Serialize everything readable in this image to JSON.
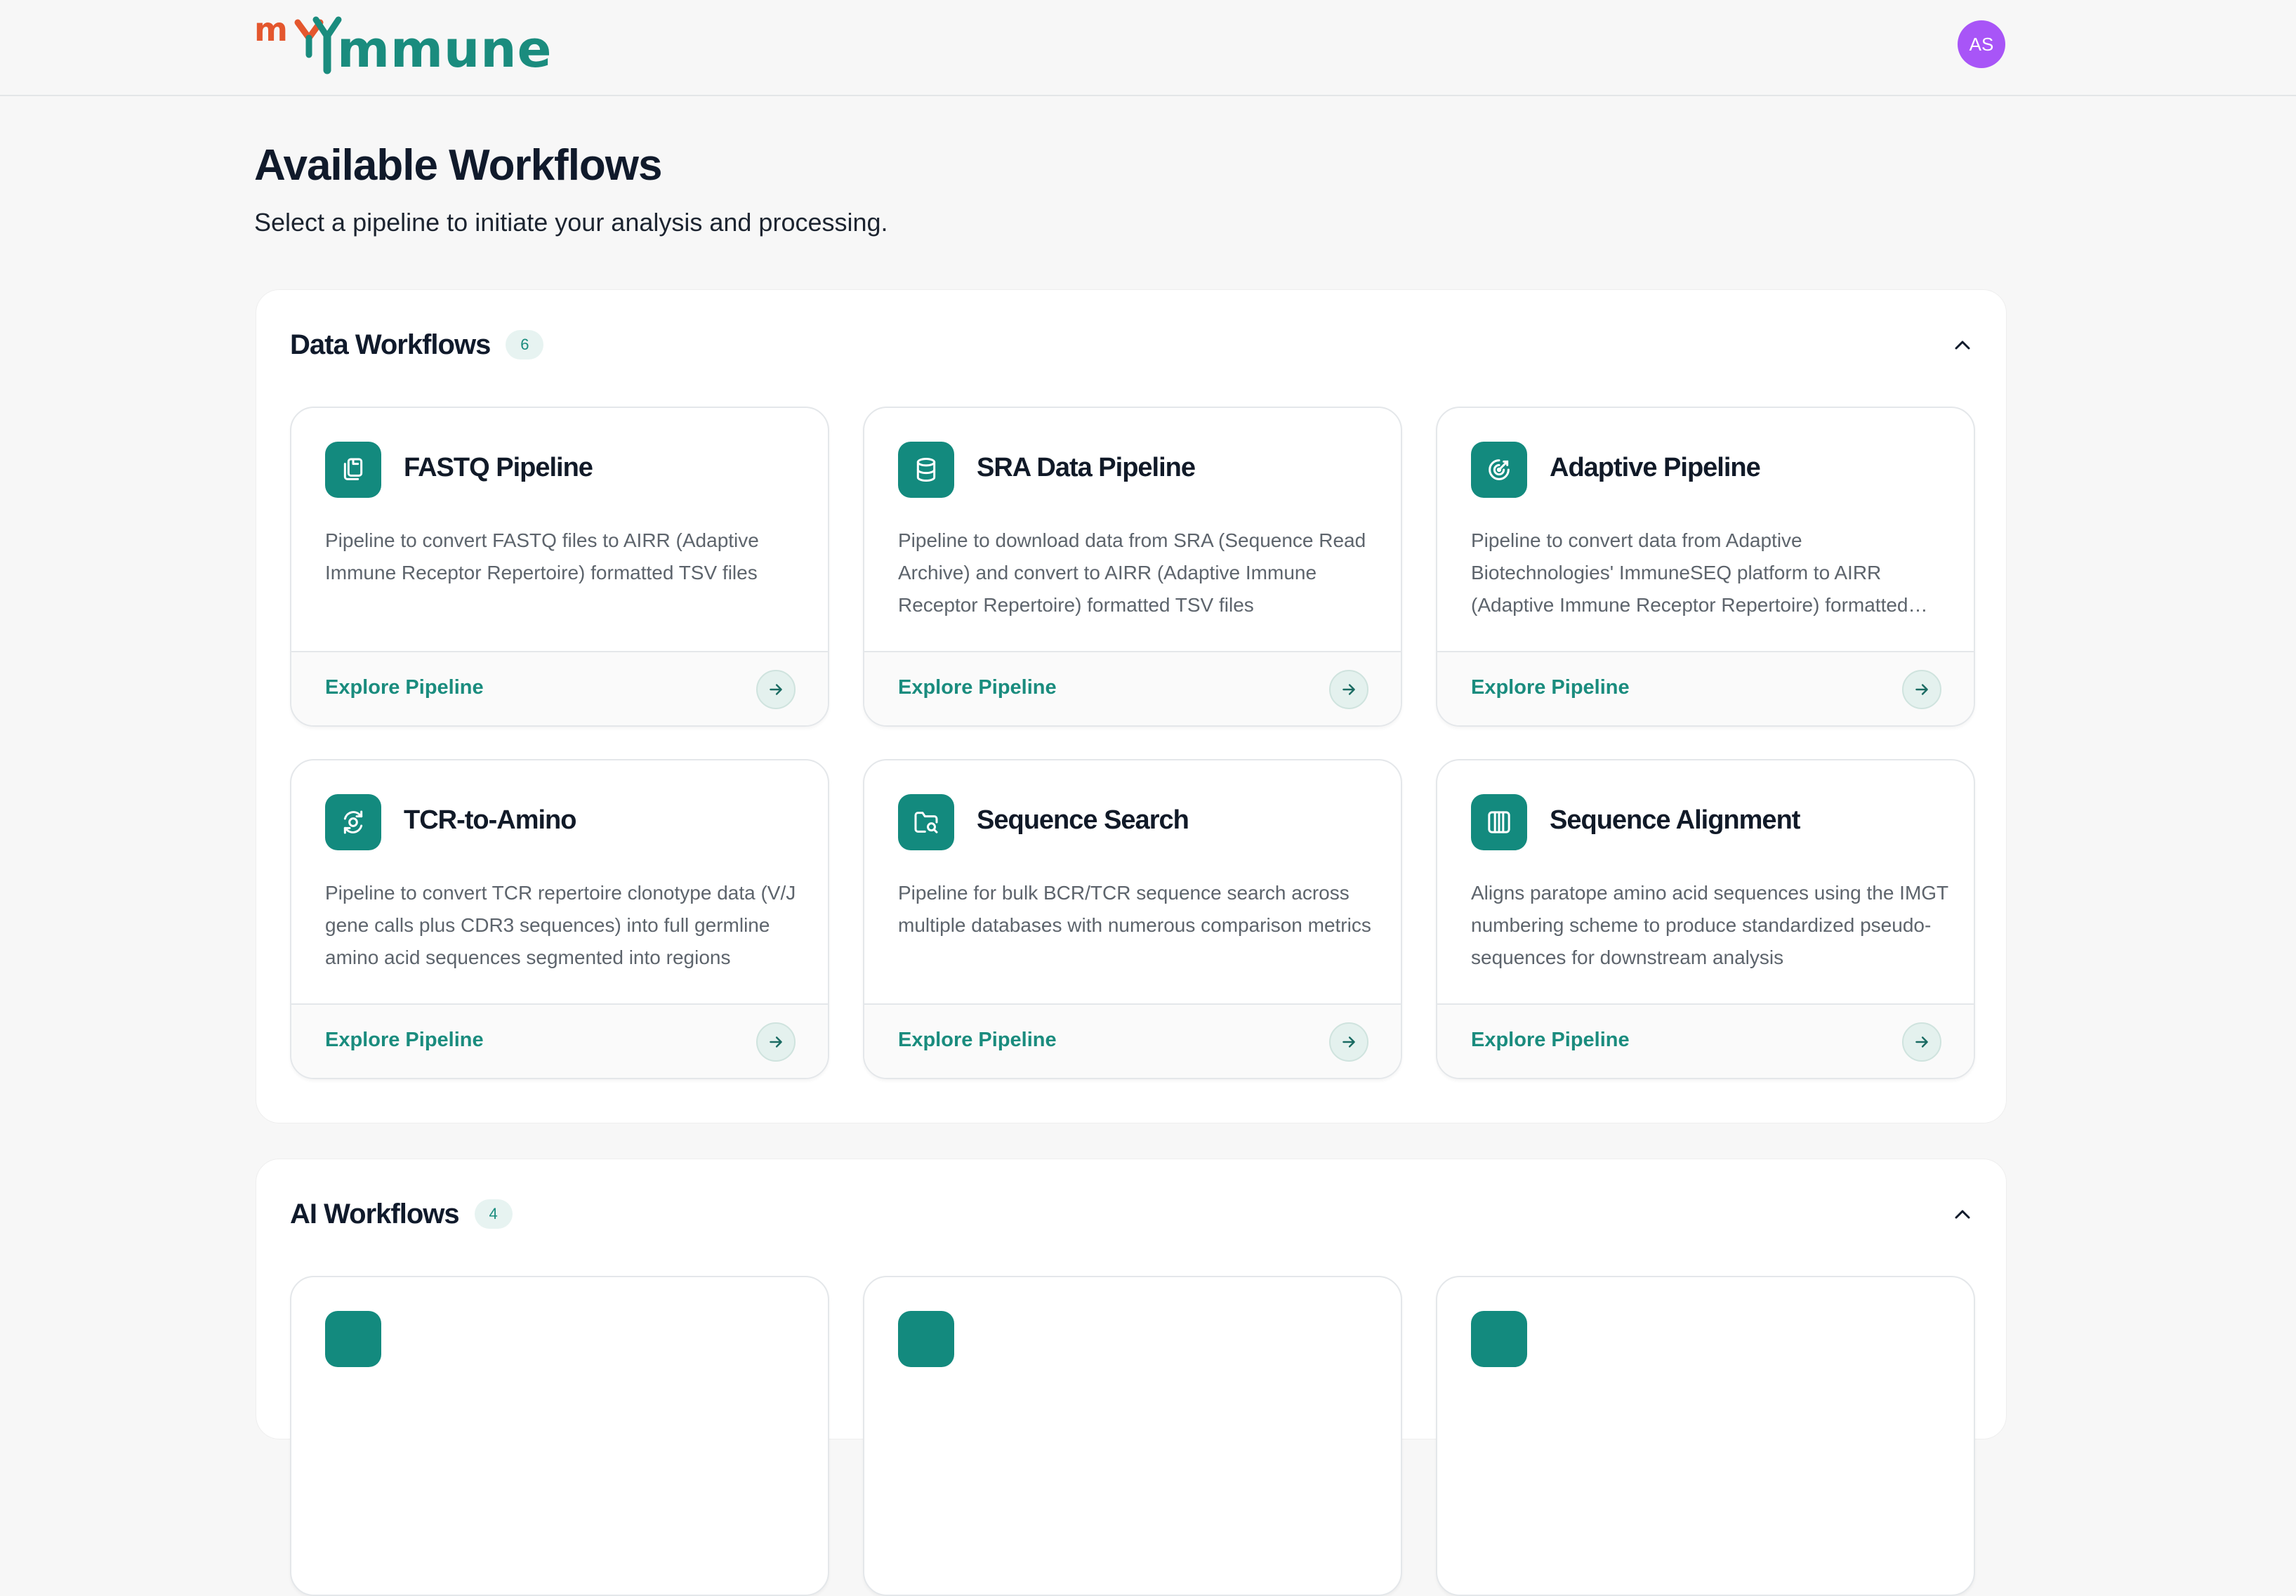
{
  "header": {
    "logo_text": "myImmune",
    "avatar_initials": "AS"
  },
  "page": {
    "title": "Available Workflows",
    "subtitle": "Select a pipeline to initiate your analysis and processing."
  },
  "sections": [
    {
      "title": "Data Workflows",
      "count": "6",
      "cards": [
        {
          "title": "FASTQ Pipeline",
          "icon": "copy-files-icon",
          "description": "Pipeline to convert FASTQ files to AIRR (Adaptive Immune Receptor Repertoire) formatted TSV files",
          "link_label": "Explore Pipeline"
        },
        {
          "title": "SRA Data Pipeline",
          "icon": "database-icon",
          "description": "Pipeline to download data from SRA (Sequence Read Archive) and convert to AIRR (Adaptive Immune Receptor Repertoire) formatted TSV files",
          "link_label": "Explore Pipeline"
        },
        {
          "title": "Adaptive Pipeline",
          "icon": "target-icon",
          "description": "Pipeline to convert data from Adaptive Biotechnologies' ImmuneSEQ platform to AIRR (Adaptive Immune Receptor Repertoire) formatted TSV files",
          "link_label": "Explore Pipeline"
        },
        {
          "title": "TCR-to-Amino",
          "icon": "convert-arrows-icon",
          "description": "Pipeline to convert TCR repertoire clonotype data (V/J gene calls plus CDR3 sequences) into full germline amino acid sequences segmented into regions",
          "link_label": "Explore Pipeline"
        },
        {
          "title": "Sequence Search",
          "icon": "folder-search-icon",
          "description": "Pipeline for bulk BCR/TCR sequence search across multiple databases with numerous comparison metrics",
          "link_label": "Explore Pipeline"
        },
        {
          "title": "Sequence Alignment",
          "icon": "columns-icon",
          "description": "Aligns paratope amino acid sequences using the IMGT numbering scheme to produce standardized pseudo-sequences for downstream analysis",
          "link_label": "Explore Pipeline"
        }
      ]
    },
    {
      "title": "AI Workflows",
      "count": "4"
    }
  ],
  "colors": {
    "accent": "#1a8c7e",
    "icon_bg": "#138a7e",
    "avatar": "#a855f7",
    "logo_my": "#e4572e",
    "background": "#f7f7f7"
  }
}
